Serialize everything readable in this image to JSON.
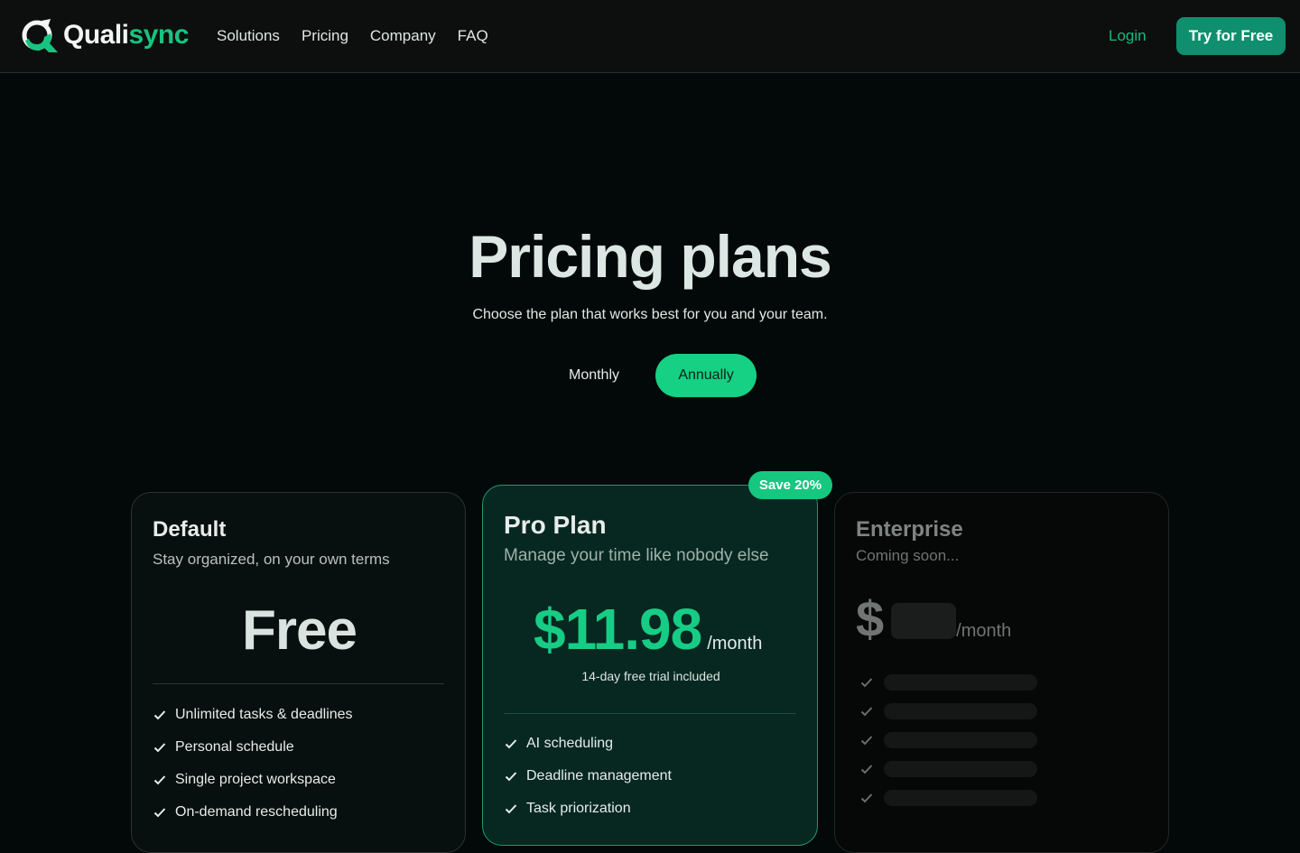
{
  "brand": {
    "name_part1": "Quali",
    "name_part2": "sync",
    "accent": "#16c47f"
  },
  "nav": {
    "items": [
      "Solutions",
      "Pricing",
      "Company",
      "FAQ"
    ],
    "login_label": "Login",
    "cta_label": "Try for Free"
  },
  "hero": {
    "title": "Pricing plans",
    "subtitle": "Choose the plan that works best for you and your team."
  },
  "billing_toggle": {
    "monthly_label": "Monthly",
    "annually_label": "Annually",
    "selected": "Annually"
  },
  "plans": {
    "default": {
      "name": "Default",
      "description": "Stay organized, on your own terms",
      "price": "Free",
      "features": [
        "Unlimited tasks & deadlines",
        "Personal schedule",
        "Single project workspace",
        "On-demand rescheduling"
      ]
    },
    "pro": {
      "badge": "Save 20%",
      "name": "Pro Plan",
      "description": "Manage your time like nobody else",
      "price": "$11.98",
      "period": "/month",
      "trial_note": "14-day free trial included",
      "features": [
        "AI scheduling",
        "Deadline management",
        "Task priorization"
      ]
    },
    "enterprise": {
      "name": "Enterprise",
      "description": "Coming soon...",
      "currency": "$",
      "period": "/month",
      "placeholder_feature_count": 5
    }
  }
}
